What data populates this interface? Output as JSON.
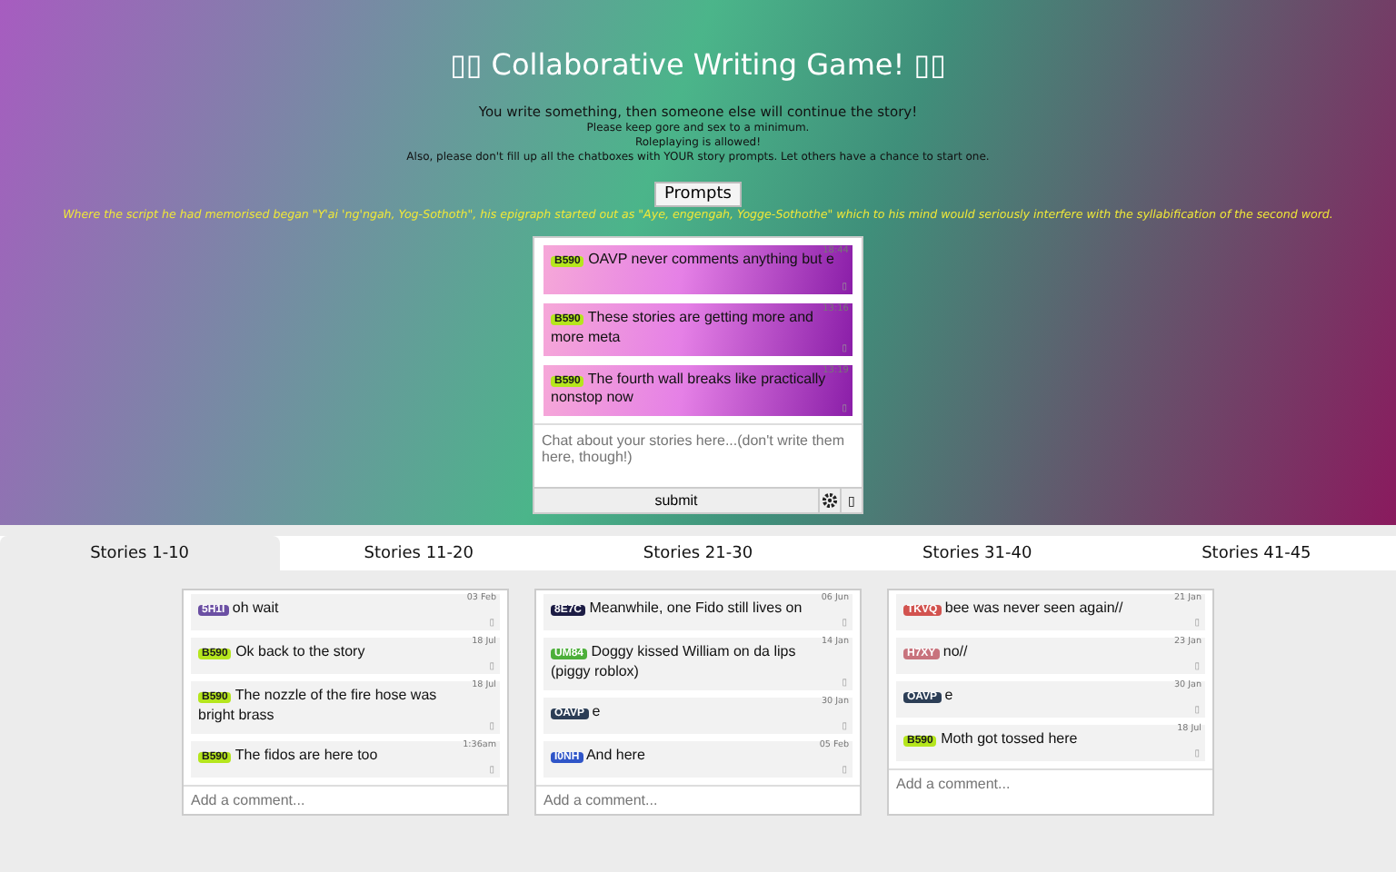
{
  "header": {
    "title": "▯▯ Collaborative Writing Game! ▯▯",
    "intro": "You write something, then someone else will continue the story!",
    "rules": [
      "Please keep gore and sex to a minimum.",
      "Roleplaying is allowed!",
      "Also, please don't fill up all the chatboxes with YOUR story prompts. Let others have a chance to start one."
    ],
    "prompts_button": "Prompts",
    "quote": "Where the script he had memorised began \"Y'ai 'ng'ngah, Yog-Sothoth\", his epigraph started out as \"Aye, engengah, Yogge-Sothothe\" which to his mind would seriously interfere with the syllabification of the second word."
  },
  "chat": {
    "messages": [
      {
        "user": "B590",
        "color": "#b5e61d",
        "text": "OAVP never comments anything but e",
        "time": "18:44",
        "mark": "▯"
      },
      {
        "user": "B590",
        "color": "#b5e61d",
        "text": "These stories are getting more and more meta",
        "time": "13:16",
        "mark": "▯"
      },
      {
        "user": "B590",
        "color": "#b5e61d",
        "text": "The fourth wall breaks like practically nonstop now",
        "time": "13:19",
        "mark": "▯"
      }
    ],
    "placeholder": "Chat about your stories here...(don't write them here, though!)",
    "submit": "submit",
    "extra_button": "▯"
  },
  "tabs": [
    {
      "label": "Stories 1-10",
      "selected": true
    },
    {
      "label": "Stories 11-20",
      "selected": false
    },
    {
      "label": "Stories 21-30",
      "selected": false
    },
    {
      "label": "Stories 31-40",
      "selected": false
    },
    {
      "label": "Stories 41-45",
      "selected": false
    }
  ],
  "stories": [
    {
      "comments": [
        {
          "user": "5H1I",
          "color": "#6b4fa3",
          "text": "oh wait",
          "time": "03 Feb",
          "mark": "▯"
        },
        {
          "user": "B590",
          "color": "#b5e61d",
          "text": "Ok back to the story",
          "time": "18 Jul",
          "mark": "▯"
        },
        {
          "user": "B590",
          "color": "#b5e61d",
          "text": "The nozzle of the fire hose was bright brass",
          "time": "18 Jul",
          "mark": "▯"
        },
        {
          "user": "B590",
          "color": "#b5e61d",
          "text": "The fidos are here too",
          "time": "1:36am",
          "mark": "▯"
        }
      ],
      "placeholder": "Add a comment..."
    },
    {
      "comments": [
        {
          "user": "8E7C",
          "color": "#1c1c44",
          "text": "Meanwhile, one Fido still lives on",
          "time": "06 Jun",
          "mark": "▯"
        },
        {
          "user": "UM84",
          "color": "#4caf3a",
          "text": "Doggy kissed William on da lips (piggy roblox)",
          "time": "14 Jan",
          "mark": "▯"
        },
        {
          "user": "OAVP",
          "color": "#2c3e56",
          "text": "e",
          "time": "30 Jan",
          "mark": "▯"
        },
        {
          "user": "I0NH",
          "color": "#2f55c8",
          "text": "And here",
          "time": "05 Feb",
          "mark": "▯"
        }
      ],
      "placeholder": "Add a comment..."
    },
    {
      "comments": [
        {
          "user": "TKVQ",
          "color": "#d2534f",
          "text": "bee was never seen again//",
          "time": "21 Jan",
          "mark": "▯"
        },
        {
          "user": "H7XY",
          "color": "#c8737d",
          "text": "no//",
          "time": "23 Jan",
          "mark": "▯"
        },
        {
          "user": "OAVP",
          "color": "#2c3e56",
          "text": "e",
          "time": "30 Jan",
          "mark": "▯"
        },
        {
          "user": "B590",
          "color": "#b5e61d",
          "text": "Moth got tossed here",
          "time": "18 Jul",
          "mark": "▯"
        }
      ],
      "placeholder": "Add a comment..."
    }
  ]
}
